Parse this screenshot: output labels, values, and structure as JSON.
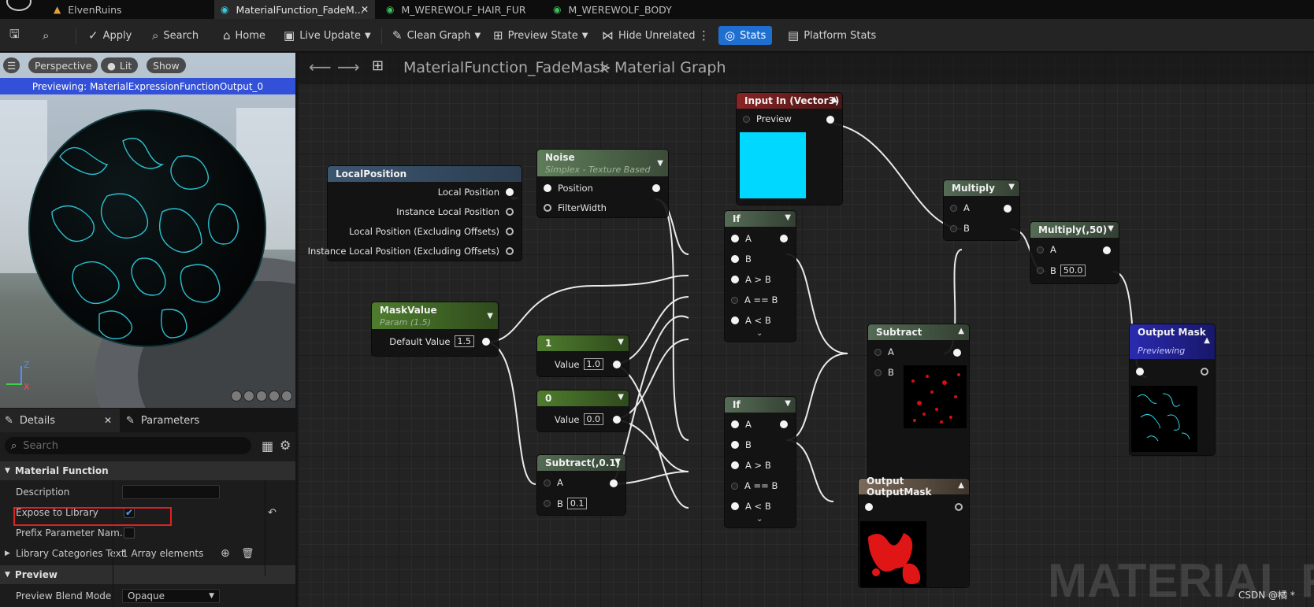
{
  "tabs": [
    {
      "label": "ElvenRuins"
    },
    {
      "label": "MaterialFunction_FadeM..."
    },
    {
      "label": "M_WEREWOLF_HAIR_FUR"
    },
    {
      "label": "M_WEREWOLF_BODY"
    }
  ],
  "toolbar": {
    "apply": "Apply",
    "search": "Search",
    "home": "Home",
    "live_update": "Live Update",
    "clean_graph": "Clean Graph",
    "preview_state": "Preview State",
    "hide_unrelated": "Hide Unrelated",
    "stats": "Stats",
    "platform_stats": "Platform Stats"
  },
  "viewport": {
    "perspective": "Perspective",
    "lit": "Lit",
    "show": "Show",
    "preview_label": "Previewing: MaterialExpressionFunctionOutput_0",
    "axis_z": "Z",
    "axis_x": "X"
  },
  "details": {
    "tab_details": "Details",
    "tab_parameters": "Parameters",
    "search_placeholder": "Search",
    "section_material_function": "Material Function",
    "description_label": "Description",
    "expose_label": "Expose to Library",
    "prefix_label": "Prefix Parameter Nam...",
    "library_label": "Library Categories Text",
    "library_value": "1 Array elements",
    "section_preview": "Preview",
    "blend_label": "Preview Blend Mode",
    "blend_value": "Opaque"
  },
  "graph": {
    "breadcrumb_root": "MaterialFunction_FadeMask",
    "breadcrumb_sep": ">",
    "breadcrumb_leaf": "Material Graph",
    "watermark": "MATERIAL FU",
    "csdn": "CSDN @橘 *"
  },
  "nodes": {
    "local_position": {
      "title": "LocalPosition",
      "pins": [
        "Local Position",
        "Instance Local Position",
        "Local Position (Excluding Offsets)",
        "Instance Local Position (Excluding Offsets)"
      ]
    },
    "noise": {
      "title": "Noise",
      "subtitle": "Simplex - Texture Based",
      "pins": [
        "Position",
        "FilterWidth"
      ]
    },
    "input_in": {
      "title": "Input In (Vector3)",
      "pin": "Preview"
    },
    "mask_value": {
      "title": "MaskValue",
      "subtitle": "Param (1.5)",
      "pin": "Default Value",
      "value": "1.5"
    },
    "const_1": {
      "title": "1",
      "pin": "Value",
      "value": "1.0"
    },
    "const_0": {
      "title": "0",
      "pin": "Value",
      "value": "0.0"
    },
    "subtract_01": {
      "title": "Subtract(,0.1)",
      "pin_a": "A",
      "pin_b": "B",
      "value": "0.1"
    },
    "if_1": {
      "title": "If",
      "pins": [
        "A",
        "B",
        "A > B",
        "A == B",
        "A < B"
      ]
    },
    "if_2": {
      "title": "If",
      "pins": [
        "A",
        "B",
        "A > B",
        "A == B",
        "A < B"
      ]
    },
    "subtract": {
      "title": "Subtract",
      "pin_a": "A",
      "pin_b": "B"
    },
    "multiply": {
      "title": "Multiply",
      "pin_a": "A",
      "pin_b": "B"
    },
    "multiply_50": {
      "title": "Multiply(,50)",
      "pin_a": "A",
      "pin_b": "B",
      "value": "50.0"
    },
    "output_mask": {
      "title": "Output Mask",
      "subtitle": "Previewing"
    },
    "output_outputmask": {
      "title": "Output OutputMask"
    }
  },
  "colors": {
    "accent": "#1f6fd1",
    "input_header": "#7a2222",
    "param_header": "#4c7a2a",
    "math_header": "#556b55",
    "output_header": "#2b2bb0",
    "preview_cyan": "#00d8ff"
  }
}
